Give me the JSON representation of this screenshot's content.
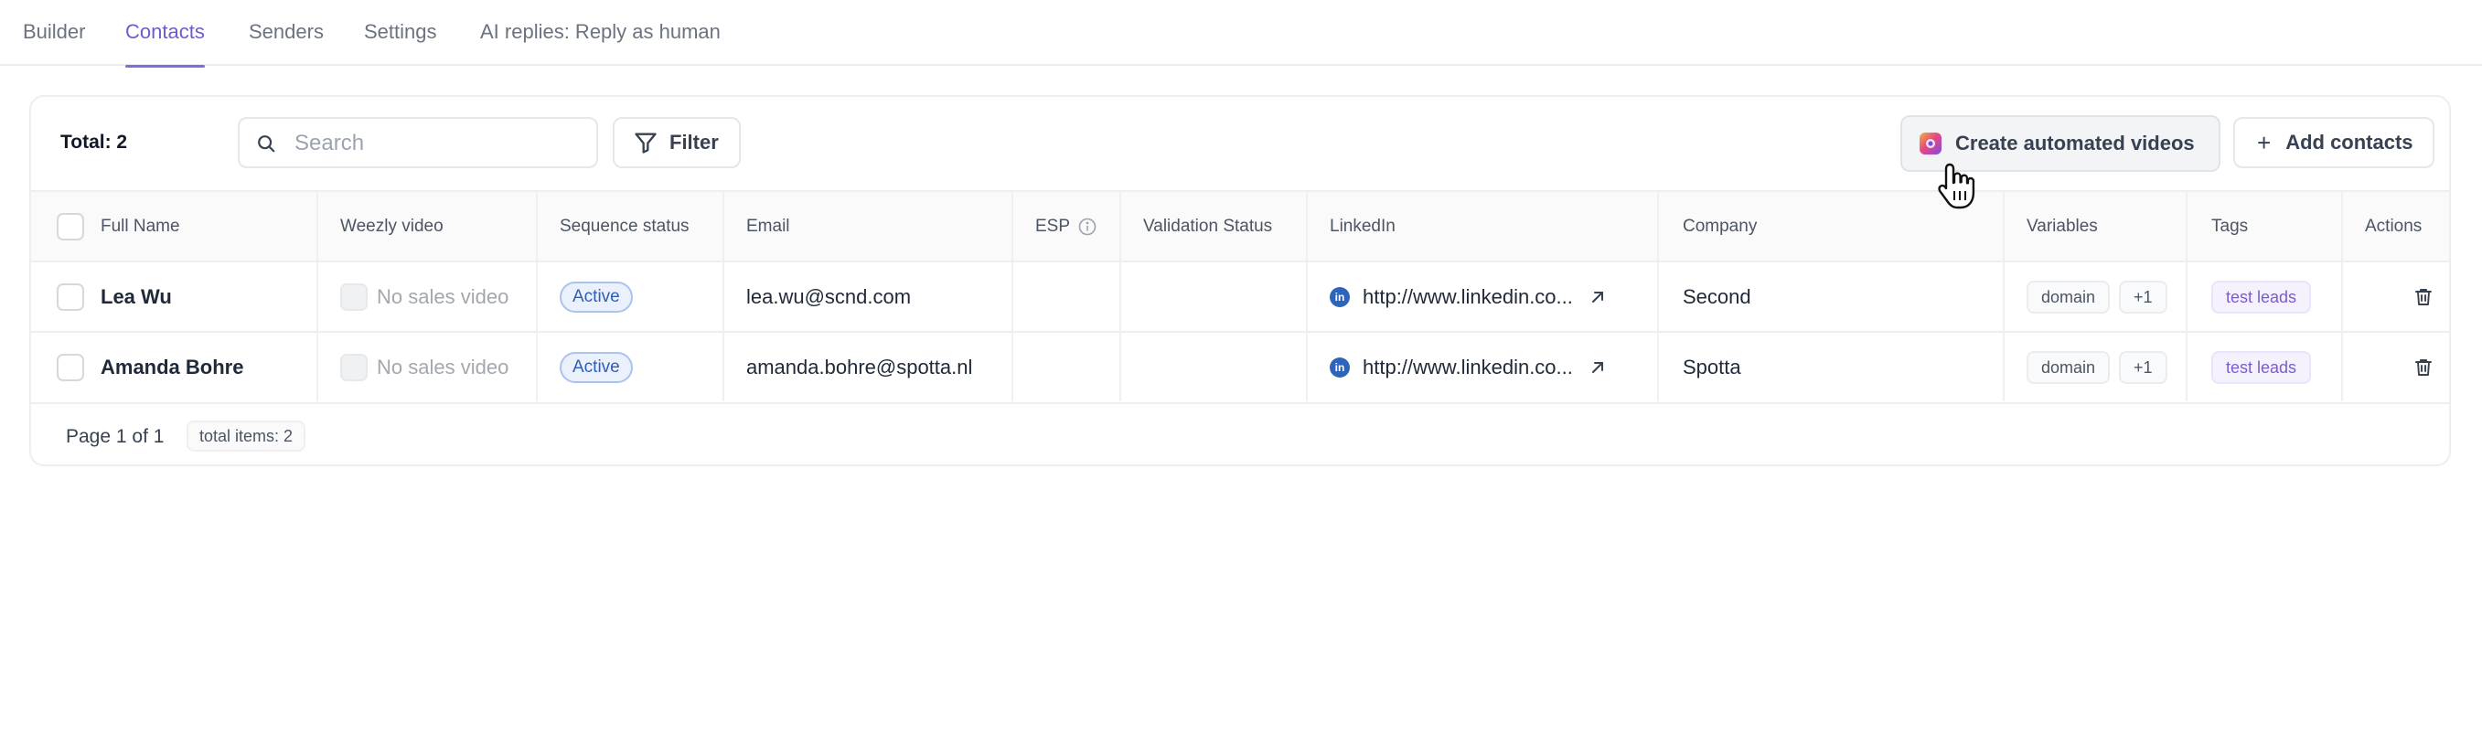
{
  "tabs": [
    {
      "label": "Builder",
      "active": false
    },
    {
      "label": "Contacts",
      "active": true
    },
    {
      "label": "Senders",
      "active": false
    },
    {
      "label": "Settings",
      "active": false
    },
    {
      "label": "AI replies: Reply as human",
      "active": false
    }
  ],
  "toolbar": {
    "total_label": "Total: 2",
    "search_placeholder": "Search",
    "filter_label": "Filter",
    "create_videos_label": "Create automated videos",
    "add_contacts_label": "Add contacts",
    "add_contacts_icon": "+"
  },
  "table": {
    "columns": [
      "Full Name",
      "Weezly video",
      "Sequence status",
      "Email",
      "ESP",
      "Validation Status",
      "LinkedIn",
      "Company",
      "Variables",
      "Tags",
      "Actions"
    ],
    "rows": [
      {
        "full_name": "Lea Wu",
        "video": "No sales video",
        "status": "Active",
        "email": "lea.wu@scnd.com",
        "esp": "",
        "validation": "",
        "linkedin_icon": "in",
        "linkedin": "http://www.linkedin.co...",
        "company": "Second",
        "variables": [
          "domain",
          "+1"
        ],
        "tags": [
          "test leads"
        ]
      },
      {
        "full_name": "Amanda Bohre",
        "video": "No sales video",
        "status": "Active",
        "email": "amanda.bohre@spotta.nl",
        "esp": "",
        "validation": "",
        "linkedin_icon": "in",
        "linkedin": "http://www.linkedin.co...",
        "company": "Spotta",
        "variables": [
          "domain",
          "+1"
        ],
        "tags": [
          "test leads"
        ]
      }
    ]
  },
  "footer": {
    "page_label": "Page 1 of 1",
    "total_items": "total items: 2"
  },
  "colors": {
    "accent": "#6d5bd0",
    "status_active_bg": "#eaf1fd",
    "status_active_text": "#2f5fb3",
    "tag_text": "#7a5bd1",
    "linkedin": "#2d64bc"
  }
}
